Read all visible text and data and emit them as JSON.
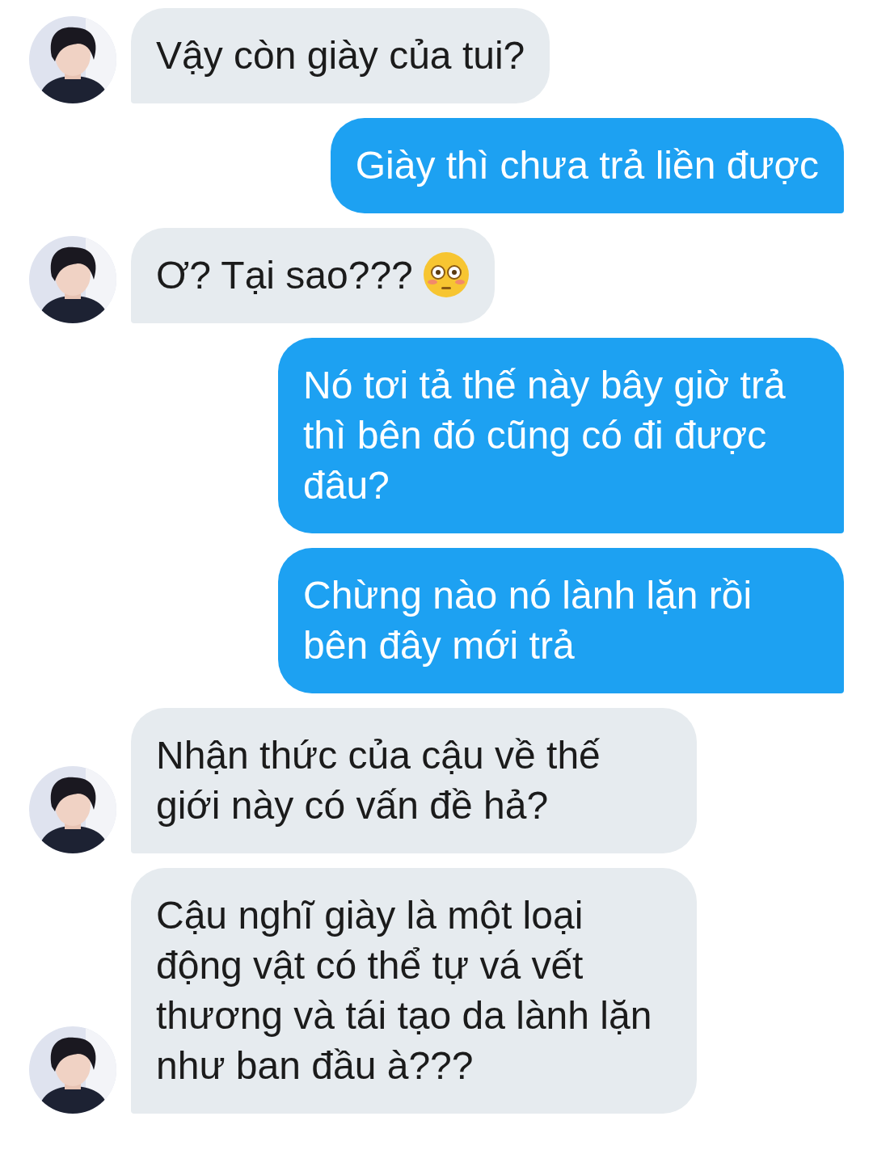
{
  "messages": [
    {
      "kind": "incoming",
      "text": "Vậy còn giày của tui?"
    },
    {
      "kind": "outgoing",
      "text": "Giày thì chưa trả liền được"
    },
    {
      "kind": "incoming",
      "text": "Ơ? Tại sao???",
      "emoji": true
    },
    {
      "kind": "outgoing",
      "text": "Nó tơi tả thế này bây giờ trả thì bên đó cũng có đi được đâu?"
    },
    {
      "kind": "outgoing",
      "text": "Chừng nào nó lành lặn rồi bên đây mới trả"
    },
    {
      "kind": "incoming",
      "text": "Nhận thức của cậu về thế giới này có vấn đề hả?"
    },
    {
      "kind": "incoming",
      "text": "Cậu nghĩ giày là một loại động vật có thể tự vá vết thương và tái tạo da lành lặn như ban đầu à???"
    }
  ]
}
